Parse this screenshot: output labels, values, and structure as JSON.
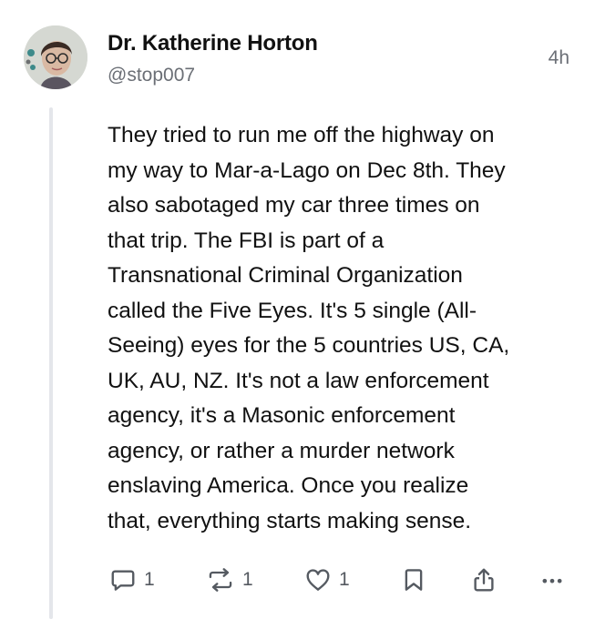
{
  "post": {
    "author_name": "Dr. Katherine Horton",
    "handle": "@stop007",
    "timestamp": "4h",
    "body_lines": [
      "They tried to run me off the highway on",
      "my way to Mar-a-Lago on Dec 8th. They",
      "also sabotaged my car three times on",
      "that trip. The FBI is part of a",
      "Transnational Criminal Organization",
      "called the Five Eyes. It's 5 single (All-",
      "Seeing) eyes for the 5 countries US, CA,",
      "UK, AU, NZ. It's not a law enforcement",
      "agency, it's a Masonic enforcement",
      "agency, or rather a murder network",
      "enslaving America. Once you realize",
      "that, everything starts making sense."
    ]
  },
  "actions": {
    "reply": {
      "icon": "reply-icon",
      "count": "1"
    },
    "repost": {
      "icon": "repost-icon",
      "count": "1"
    },
    "like": {
      "icon": "heart-icon",
      "count": "1"
    },
    "bookmark": {
      "icon": "bookmark-icon"
    },
    "share": {
      "icon": "share-icon"
    },
    "more": {
      "icon": "more-icon"
    }
  },
  "colors": {
    "text": "#111111",
    "muted": "#6b6f76",
    "icon": "#555a61",
    "thread_line": "#e4e6ea"
  }
}
